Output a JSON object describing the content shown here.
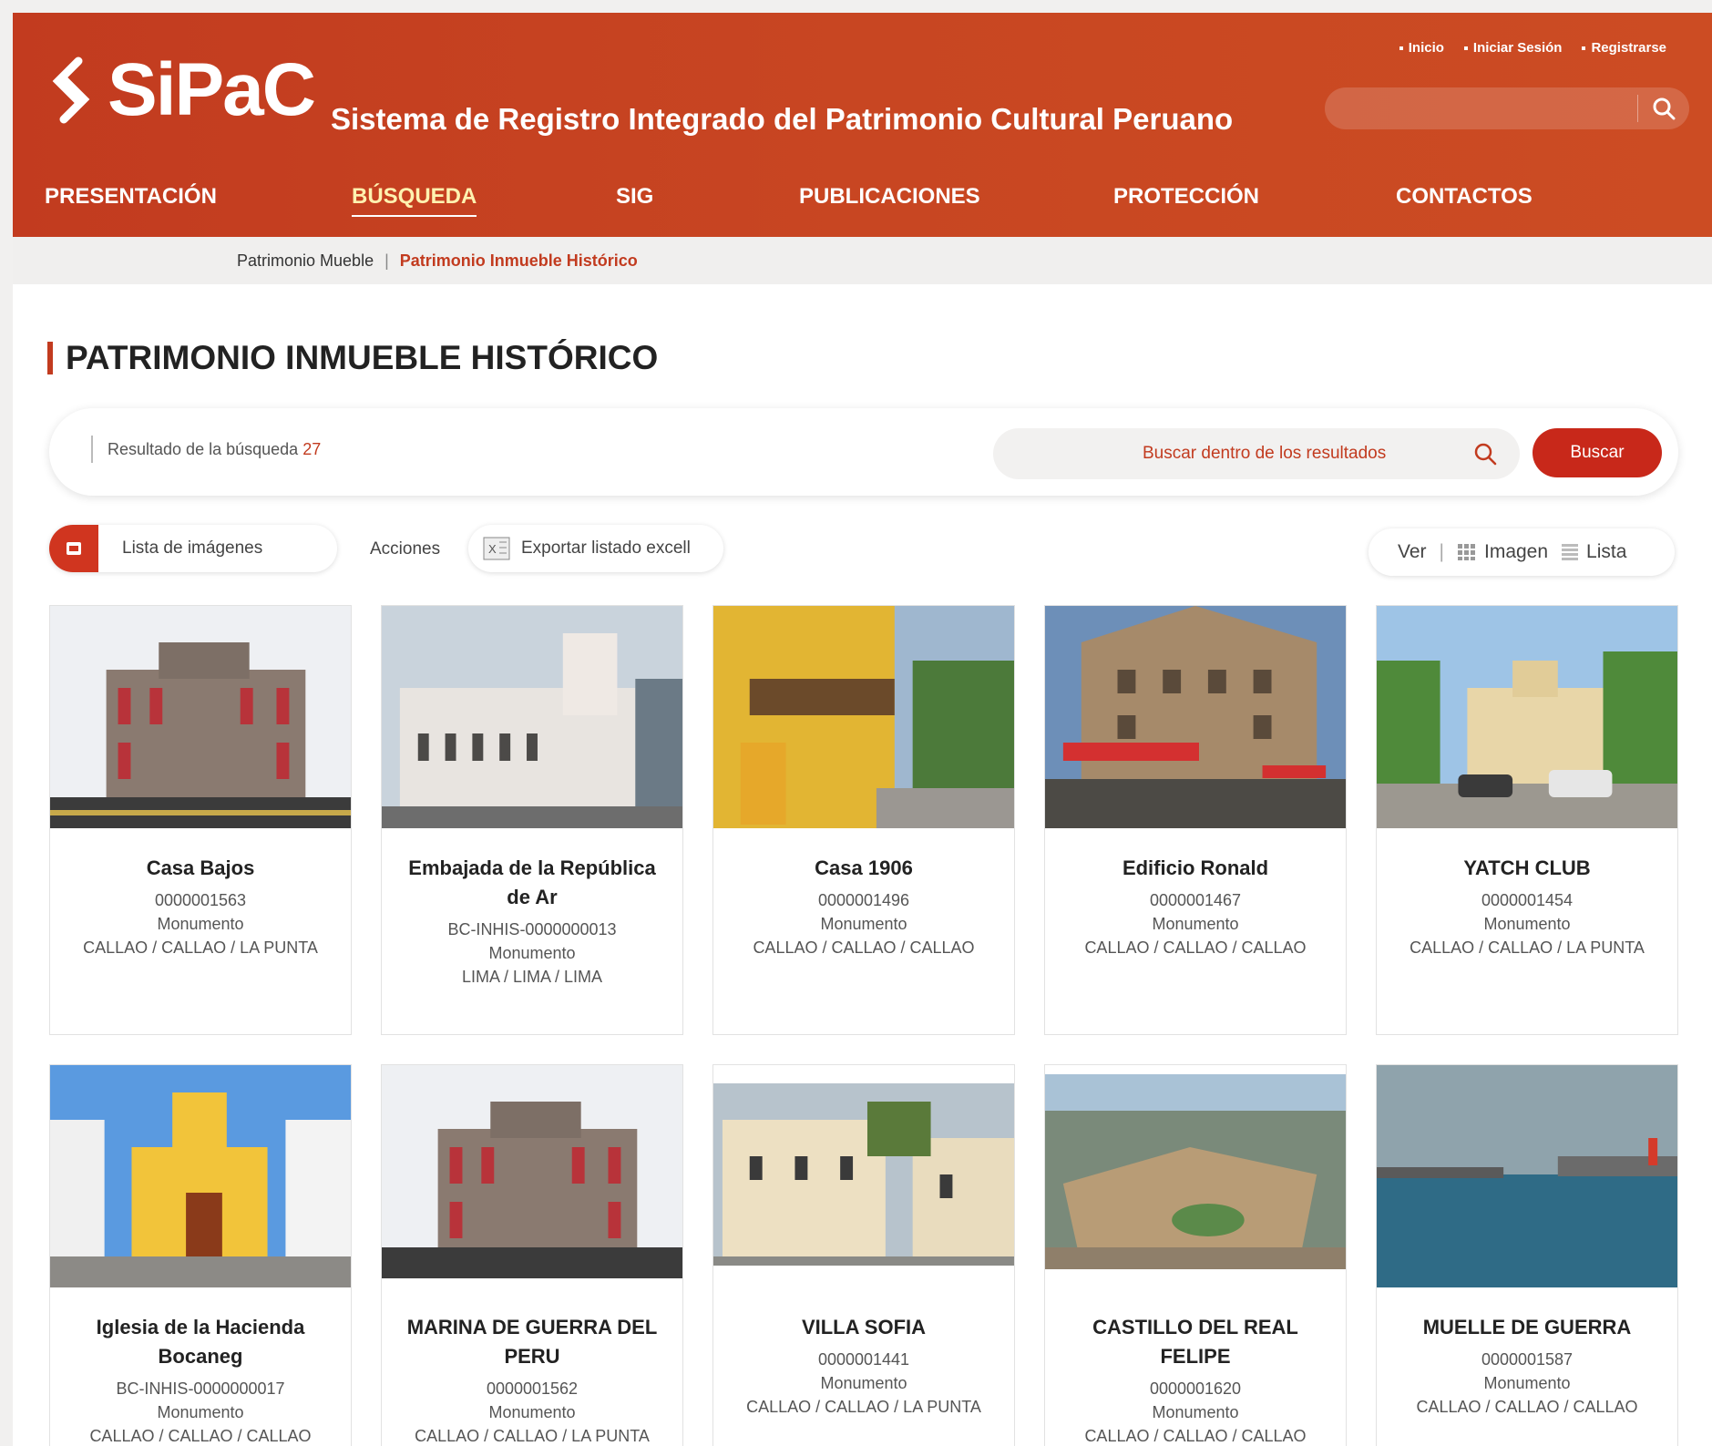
{
  "header": {
    "logo_text": "SiPaC",
    "site_title": "Sistema de Registro Integrado del Patrimonio Cultural Peruano",
    "top_links": [
      "Inicio",
      "Iniciar Sesión",
      "Registrarse"
    ],
    "nav": [
      "PRESENTACIÓN",
      "BÚSQUEDA",
      "SIG",
      "PUBLICACIONES",
      "PROTECCIÓN",
      "CONTACTOS"
    ],
    "active_nav": "BÚSQUEDA"
  },
  "subnav": {
    "item1": "Patrimonio Mueble",
    "separator": "|",
    "item2": "Patrimonio Inmueble Histórico"
  },
  "page_title": "PATRIMONIO INMUEBLE HISTÓRICO",
  "results": {
    "label": "Resultado de la búsqueda",
    "count": "27",
    "search_placeholder": "Buscar dentro de los resultados",
    "search_button": "Buscar"
  },
  "toolbar": {
    "image_list": "Lista de imágenes",
    "actions": "Acciones",
    "export": "Exportar listado excell",
    "view_label": "Ver",
    "view_image": "Imagen",
    "view_list": "Lista"
  },
  "cards": [
    {
      "title": "Casa Bajos",
      "code": "0000001563",
      "type": "Monumento",
      "location": "CALLAO / CALLAO / LA PUNTA"
    },
    {
      "title": "Embajada de la República de Ar",
      "code": "BC-INHIS-0000000013",
      "type": "Monumento",
      "location": "LIMA / LIMA / LIMA"
    },
    {
      "title": "Casa 1906",
      "code": "0000001496",
      "type": "Monumento",
      "location": "CALLAO / CALLAO / CALLAO"
    },
    {
      "title": "Edificio Ronald",
      "code": "0000001467",
      "type": "Monumento",
      "location": "CALLAO / CALLAO / CALLAO"
    },
    {
      "title": "YATCH CLUB",
      "code": "0000001454",
      "type": "Monumento",
      "location": "CALLAO / CALLAO / LA PUNTA"
    },
    {
      "title": "Iglesia de la Hacienda Bocaneg",
      "code": "BC-INHIS-0000000017",
      "type": "Monumento",
      "location": "CALLAO / CALLAO / CALLAO"
    },
    {
      "title": "MARINA DE GUERRA DEL PERU",
      "code": "0000001562",
      "type": "Monumento",
      "location": "CALLAO / CALLAO / LA PUNTA"
    },
    {
      "title": "VILLA SOFIA",
      "code": "0000001441",
      "type": "Monumento",
      "location": "CALLAO / CALLAO / LA PUNTA"
    },
    {
      "title": "CASTILLO DEL REAL FELIPE",
      "code": "0000001620",
      "type": "Monumento",
      "location": "CALLAO / CALLAO / CALLAO"
    },
    {
      "title": "MUELLE DE GUERRA",
      "code": "0000001587",
      "type": "Monumento",
      "location": "CALLAO / CALLAO / CALLAO"
    }
  ],
  "colors": {
    "brand": "#c23b1f",
    "button": "#c8281a"
  }
}
